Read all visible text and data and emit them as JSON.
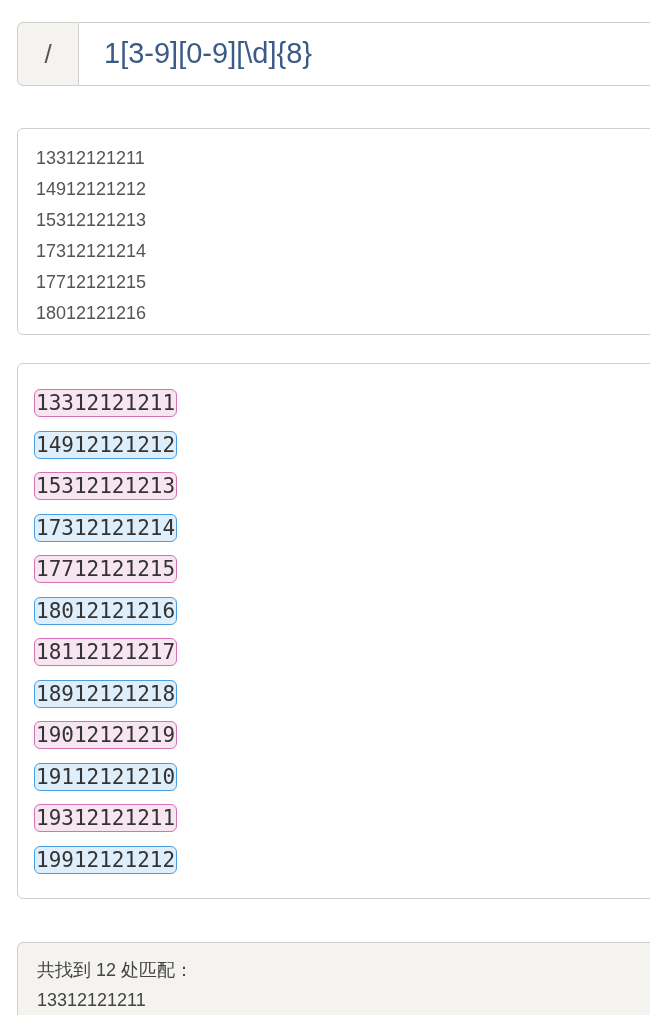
{
  "pattern": {
    "delimiter": "/",
    "regex": "1[3-9][0-9][\\d]{8}"
  },
  "input": {
    "lines": [
      "13312121211",
      "14912121212",
      "15312121213",
      "17312121214",
      "17712121215",
      "18012121216"
    ]
  },
  "matches": [
    {
      "text": "13312121211",
      "color": "#d472b6"
    },
    {
      "text": "14912121212",
      "color": "#4a9fe2"
    },
    {
      "text": "15312121213",
      "color": "#d472b6"
    },
    {
      "text": "17312121214",
      "color": "#4a9fe2"
    },
    {
      "text": "17712121215",
      "color": "#d472b6"
    },
    {
      "text": "18012121216",
      "color": "#4a9fe2"
    },
    {
      "text": "18112121217",
      "color": "#d472b6"
    },
    {
      "text": "18912121218",
      "color": "#4a9fe2"
    },
    {
      "text": "19012121219",
      "color": "#d472b6"
    },
    {
      "text": "19112121210",
      "color": "#4a9fe2"
    },
    {
      "text": "19312121211",
      "color": "#d472b6"
    },
    {
      "text": "19912121212",
      "color": "#4a9fe2"
    }
  ],
  "summary": {
    "heading": "共找到 12 处匹配：",
    "lines": [
      "13312121211"
    ]
  }
}
